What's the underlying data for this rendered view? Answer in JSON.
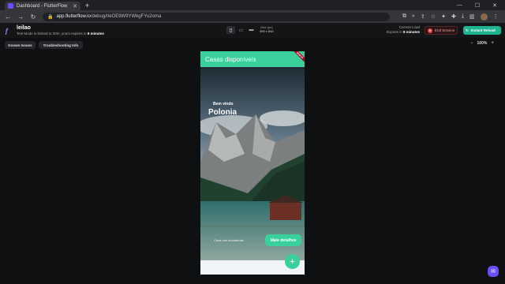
{
  "browser": {
    "tab_title": "Dashboard - FlutterFlow",
    "url_host": "app.flutterflow.io",
    "url_path": "/debug/rleOE9W9YWkgFYu2oma"
  },
  "toolbar": {
    "app_name": "leilao",
    "test_mode_text": "Test Mode is limited to 30m, yours expires in",
    "test_mode_remaining": "8 minutes",
    "size_label": "One (pv)",
    "size_value": "390 x 844",
    "current_load_label": "Current Load",
    "expires_label": "Expires in",
    "expires_value": "8 minutes",
    "end_session_label": "End Session",
    "instant_reload_label": "Instant Reload"
  },
  "subtoolbar": {
    "known_issues_label": "Known Issues",
    "troubleshooting_label": "Troubleshooting Info",
    "zoom_minus": "−",
    "zoom_level": "100%",
    "zoom_plus": "+"
  },
  "preview": {
    "appbar_title": "Casas disponiveis",
    "debug_banner": "DEBUG",
    "welcome_text": "Bem vindo",
    "city_name": "Polonia",
    "caption": "Casa nas montanhas",
    "more_button_label": "Mais detalhes",
    "fab_label": "+"
  },
  "colors": {
    "accent": "#39d09b",
    "end_session": "#e5484d",
    "instant_reload": "#1fb38f",
    "brand": "#6b4ef6"
  }
}
